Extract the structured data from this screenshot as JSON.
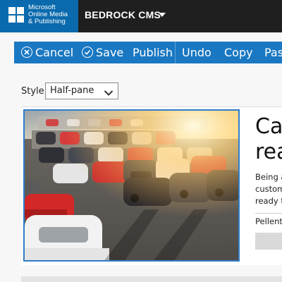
{
  "header": {
    "logo_lines": [
      "Microsoft",
      "Online Media",
      "& Publishing"
    ],
    "app_title": "BEDROCK CMS"
  },
  "toolbar": {
    "cancel": "Cancel",
    "save": "Save",
    "publish": "Publish",
    "undo": "Undo",
    "copy": "Copy",
    "paste": "Past"
  },
  "editor": {
    "style_label": "Style",
    "style_value": "Half-pane",
    "headline_lines": [
      "Ca",
      "rea"
    ],
    "body_lines": [
      "Being a",
      "custom",
      "ready t"
    ],
    "pellent": "Pellent"
  },
  "colors": {
    "header_bg": "#1f1f1f",
    "logo_bg": "#0a6aad",
    "toolbar_bg": "#1a78c2",
    "selection_border": "#2f7ec8"
  }
}
